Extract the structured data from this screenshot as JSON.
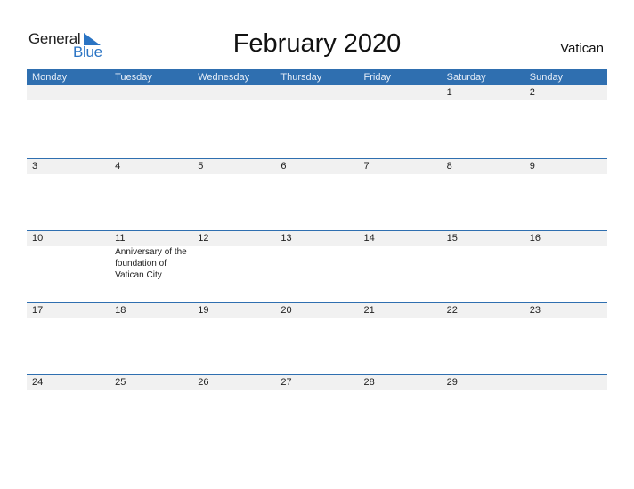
{
  "logo": {
    "line1": "General",
    "line2": "Blue",
    "accent_color": "#2a74c4"
  },
  "title": "February 2020",
  "country": "Vatican",
  "header": {
    "days": [
      "Monday",
      "Tuesday",
      "Wednesday",
      "Thursday",
      "Friday",
      "Saturday",
      "Sunday"
    ],
    "color": "#2f6fb0"
  },
  "weeks": [
    {
      "days": [
        {
          "date": "",
          "event": ""
        },
        {
          "date": "",
          "event": ""
        },
        {
          "date": "",
          "event": ""
        },
        {
          "date": "",
          "event": ""
        },
        {
          "date": "",
          "event": ""
        },
        {
          "date": "1",
          "event": ""
        },
        {
          "date": "2",
          "event": ""
        }
      ]
    },
    {
      "days": [
        {
          "date": "3",
          "event": ""
        },
        {
          "date": "4",
          "event": ""
        },
        {
          "date": "5",
          "event": ""
        },
        {
          "date": "6",
          "event": ""
        },
        {
          "date": "7",
          "event": ""
        },
        {
          "date": "8",
          "event": ""
        },
        {
          "date": "9",
          "event": ""
        }
      ]
    },
    {
      "days": [
        {
          "date": "10",
          "event": ""
        },
        {
          "date": "11",
          "event": "Anniversary of the foundation of Vatican City"
        },
        {
          "date": "12",
          "event": ""
        },
        {
          "date": "13",
          "event": ""
        },
        {
          "date": "14",
          "event": ""
        },
        {
          "date": "15",
          "event": ""
        },
        {
          "date": "16",
          "event": ""
        }
      ]
    },
    {
      "days": [
        {
          "date": "17",
          "event": ""
        },
        {
          "date": "18",
          "event": ""
        },
        {
          "date": "19",
          "event": ""
        },
        {
          "date": "20",
          "event": ""
        },
        {
          "date": "21",
          "event": ""
        },
        {
          "date": "22",
          "event": ""
        },
        {
          "date": "23",
          "event": ""
        }
      ]
    },
    {
      "days": [
        {
          "date": "24",
          "event": ""
        },
        {
          "date": "25",
          "event": ""
        },
        {
          "date": "26",
          "event": ""
        },
        {
          "date": "27",
          "event": ""
        },
        {
          "date": "28",
          "event": ""
        },
        {
          "date": "29",
          "event": ""
        },
        {
          "date": "",
          "event": ""
        }
      ]
    }
  ]
}
